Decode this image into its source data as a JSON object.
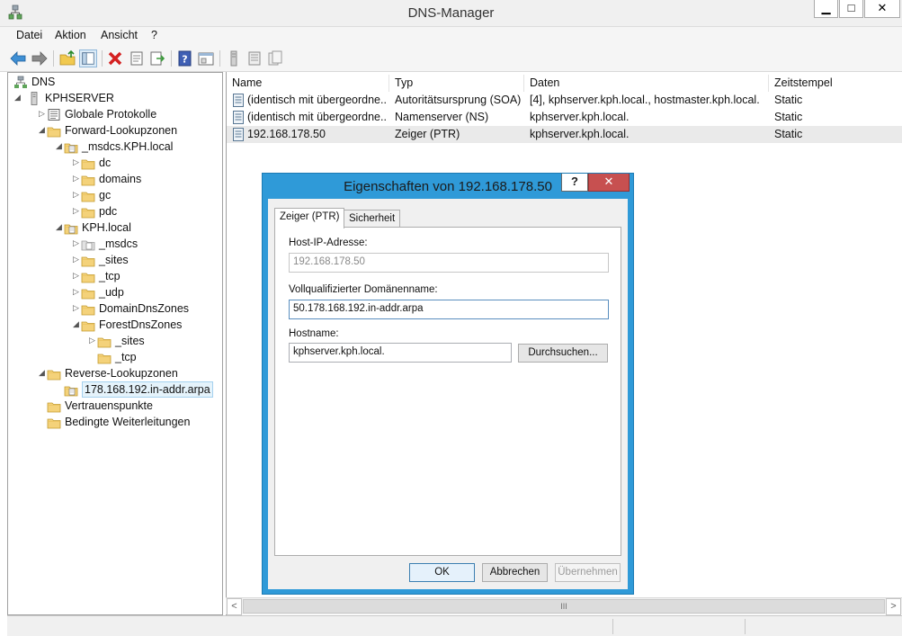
{
  "window": {
    "title": "DNS-Manager",
    "minimize": "▁",
    "maximize": "□",
    "close": "✕"
  },
  "menu": [
    "Datei",
    "Aktion",
    "Ansicht",
    "?"
  ],
  "toolbar": {
    "icons": [
      "back-icon",
      "forward-icon",
      "up-folder-icon",
      "show-hide-tree-icon",
      "delete-icon",
      "properties-icon",
      "export-icon",
      "help-icon",
      "console-icon",
      "server-icon",
      "list-icon",
      "record-icon"
    ]
  },
  "tree": {
    "items": [
      {
        "label": "DNS",
        "icon": "dns-icon",
        "level": 0,
        "expander": ""
      },
      {
        "label": "KPHSERVER",
        "icon": "server-icon",
        "level": 1,
        "expander": "◢"
      },
      {
        "label": "Globale Protokolle",
        "icon": "log-icon",
        "level": 2,
        "expander": "▷"
      },
      {
        "label": "Forward-Lookupzonen",
        "icon": "folder-icon",
        "level": 2,
        "expander": "◢"
      },
      {
        "label": "_msdcs.KPH.local",
        "icon": "zone-icon",
        "level": 3,
        "expander": "◢"
      },
      {
        "label": "dc",
        "icon": "folder-icon",
        "level": 4,
        "expander": "▷"
      },
      {
        "label": "domains",
        "icon": "folder-icon",
        "level": 4,
        "expander": "▷"
      },
      {
        "label": "gc",
        "icon": "folder-icon",
        "level": 4,
        "expander": "▷"
      },
      {
        "label": "pdc",
        "icon": "folder-icon",
        "level": 4,
        "expander": "▷"
      },
      {
        "label": "KPH.local",
        "icon": "zone-icon",
        "level": 3,
        "expander": "◢"
      },
      {
        "label": "_msdcs",
        "icon": "zone-gray-icon",
        "level": 4,
        "expander": "▷"
      },
      {
        "label": "_sites",
        "icon": "folder-icon",
        "level": 4,
        "expander": "▷"
      },
      {
        "label": "_tcp",
        "icon": "folder-icon",
        "level": 4,
        "expander": "▷"
      },
      {
        "label": "_udp",
        "icon": "folder-icon",
        "level": 4,
        "expander": "▷"
      },
      {
        "label": "DomainDnsZones",
        "icon": "folder-icon",
        "level": 4,
        "expander": "▷"
      },
      {
        "label": "ForestDnsZones",
        "icon": "folder-icon",
        "level": 4,
        "expander": "◢"
      },
      {
        "label": "_sites",
        "icon": "folder-icon",
        "level": 5,
        "expander": "▷"
      },
      {
        "label": "_tcp",
        "icon": "folder-icon",
        "level": 5,
        "expander": ""
      },
      {
        "label": "Reverse-Lookupzonen",
        "icon": "folder-icon",
        "level": 2,
        "expander": "◢"
      },
      {
        "label": "178.168.192.in-addr.arpa",
        "icon": "zone-icon",
        "level": 3,
        "expander": "",
        "selected": true
      },
      {
        "label": "Vertrauenspunkte",
        "icon": "folder-icon",
        "level": 2,
        "expander": ""
      },
      {
        "label": "Bedingte Weiterleitungen",
        "icon": "folder-icon",
        "level": 2,
        "expander": ""
      }
    ]
  },
  "list": {
    "columns": [
      "Name",
      "Typ",
      "Daten",
      "Zeitstempel"
    ],
    "rows": [
      {
        "name": "(identisch mit übergeordne...",
        "type": "Autoritätsursprung (SOA)",
        "data": "[4], kphserver.kph.local., hostmaster.kph.local.",
        "timestamp": "Static"
      },
      {
        "name": "(identisch mit übergeordne...",
        "type": "Namenserver (NS)",
        "data": "kphserver.kph.local.",
        "timestamp": "Static"
      },
      {
        "name": "192.168.178.50",
        "type": "Zeiger (PTR)",
        "data": "kphserver.kph.local.",
        "timestamp": "Static",
        "selected": true
      }
    ],
    "scroll_grip": "III"
  },
  "dialog": {
    "title": "Eigenschaften von 192.168.178.50",
    "help": "?",
    "close": "✕",
    "tabs": [
      "Zeiger (PTR)",
      "Sicherheit"
    ],
    "host_ip_label": "Host-IP-Adresse:",
    "host_ip_value": "192.168.178.50",
    "fqdn_label": "Vollqualifizierter Domänenname:",
    "fqdn_value": "50.178.168.192.in-addr.arpa",
    "hostname_label": "Hostname:",
    "hostname_value": "kphserver.kph.local.",
    "browse": "Durchsuchen...",
    "ok": "OK",
    "cancel": "Abbrechen",
    "apply": "Übernehmen"
  },
  "colors": {
    "dialog_border": "#2f9ad8",
    "close_red": "#c75050",
    "folder_yellow": "#f4d27a",
    "selection": "#e5f3fb"
  }
}
